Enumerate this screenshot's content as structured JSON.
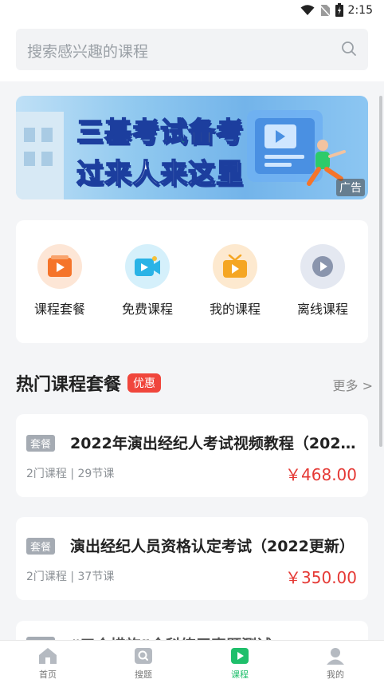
{
  "status_bar": {
    "time": "2:15"
  },
  "search": {
    "placeholder": "搜索感兴趣的课程"
  },
  "banner": {
    "line1_part1": "三基",
    "line1_part2": "考试",
    "line1_part3": "备考",
    "line2": "过来人来这里",
    "ad_label": "广告"
  },
  "quick_actions": [
    {
      "label": "课程套餐",
      "icon": "course-package-icon",
      "color": "#f5742a"
    },
    {
      "label": "免费课程",
      "icon": "free-course-icon",
      "color": "#2ab3e6"
    },
    {
      "label": "我的课程",
      "icon": "my-course-icon",
      "color": "#f5a623"
    },
    {
      "label": "离线课程",
      "icon": "offline-course-icon",
      "color": "#8a95ad"
    }
  ],
  "hot_section": {
    "title": "热门课程套餐",
    "badge": "优惠",
    "more": "更多 >"
  },
  "courses": [
    {
      "tag": "套餐",
      "title": "2022年演出经纪人考试视频教程（2022年...",
      "meta": "2门课程 | 29节课",
      "price": "￥468.00"
    },
    {
      "tag": "套餐",
      "title": "演出经纪人员资格认定考试（2022更新）",
      "meta": "2门课程 | 37节课",
      "price": "￥350.00"
    },
    {
      "tag": "套餐",
      "title": "“三个措施”全科练习真题测试"
    }
  ],
  "tabs": [
    {
      "label": "首页",
      "icon": "home-icon",
      "active": false
    },
    {
      "label": "搜题",
      "icon": "search-question-icon",
      "active": false
    },
    {
      "label": "课程",
      "icon": "course-play-icon",
      "active": true
    },
    {
      "label": "我的",
      "icon": "profile-icon",
      "active": false
    }
  ],
  "colors": {
    "accent": "#1fbf6b",
    "price": "#e53935",
    "badge": "#f0463c"
  }
}
